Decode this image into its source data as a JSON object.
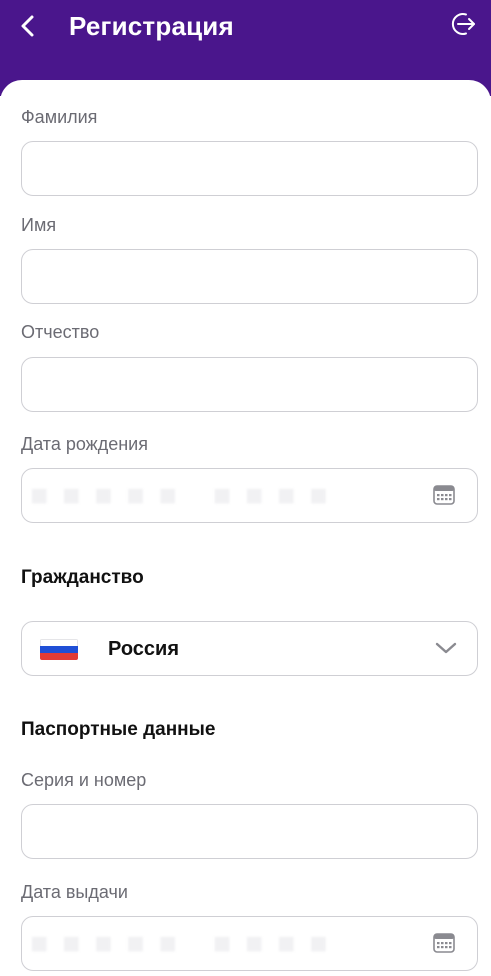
{
  "header": {
    "title": "Регистрация",
    "background": "#4a168c",
    "back_icon": "chevron-left-icon",
    "logout_icon": "logout-icon"
  },
  "form": {
    "last_name": {
      "label": "Фамилия",
      "value": ""
    },
    "first_name": {
      "label": "Имя",
      "value": ""
    },
    "middle_name": {
      "label": "Отчество",
      "value": ""
    },
    "birth_date": {
      "label": "Дата рождения",
      "value": ""
    },
    "citizenship": {
      "section_title": "Гражданство",
      "selected": "Россия",
      "flag_icon": "russia-flag-icon",
      "dropdown_icon": "chevron-down-icon"
    },
    "passport": {
      "section_title": "Паспортные данные",
      "series_number": {
        "label": "Серия и номер",
        "value": ""
      },
      "issue_date": {
        "label": "Дата выдачи",
        "value": ""
      }
    }
  },
  "colors": {
    "accent": "#4a168c",
    "label": "#6b6b73",
    "border": "#cfcfd4",
    "flag_white": "#ffffff",
    "flag_blue": "#1f4fd6",
    "flag_red": "#e23b36"
  }
}
